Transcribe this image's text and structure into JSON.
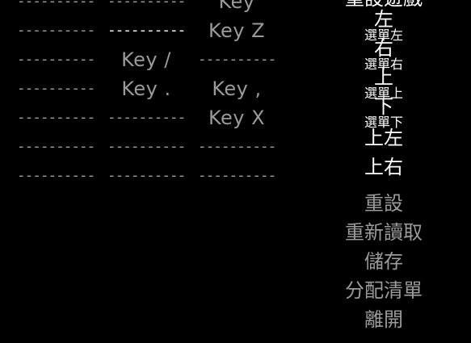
{
  "grid": {
    "rows": [
      [
        "----------",
        "----------",
        "Key"
      ],
      [
        "----------",
        "----------",
        "Key Z"
      ],
      [
        "----------",
        "Key /",
        "----------"
      ],
      [
        "----------",
        "Key .",
        "Key ,"
      ],
      [
        "----------",
        "----------",
        "Key X"
      ],
      [
        "----------",
        "----------",
        "----------"
      ],
      [
        "----------",
        "----------",
        "----------"
      ]
    ],
    "highlighted_cell": "row1-col2"
  },
  "actions": {
    "top_cut": "重設遊戲",
    "items": [
      {
        "main": "左",
        "sub": "選單左"
      },
      {
        "main": "右",
        "sub": "選單右"
      },
      {
        "main": "上",
        "sub": "選單上"
      },
      {
        "main": "下",
        "sub": "選單下"
      },
      {
        "main": "上左",
        "sub": ""
      },
      {
        "main": "上右",
        "sub": ""
      }
    ]
  },
  "menu": {
    "reset": "重設",
    "reload": "重新讀取",
    "save": "儲存",
    "assign_list": "分配清單",
    "exit": "離開"
  },
  "colors": {
    "background": "#000000",
    "text": "#9a9a9a",
    "highlight": "#ffffff"
  }
}
